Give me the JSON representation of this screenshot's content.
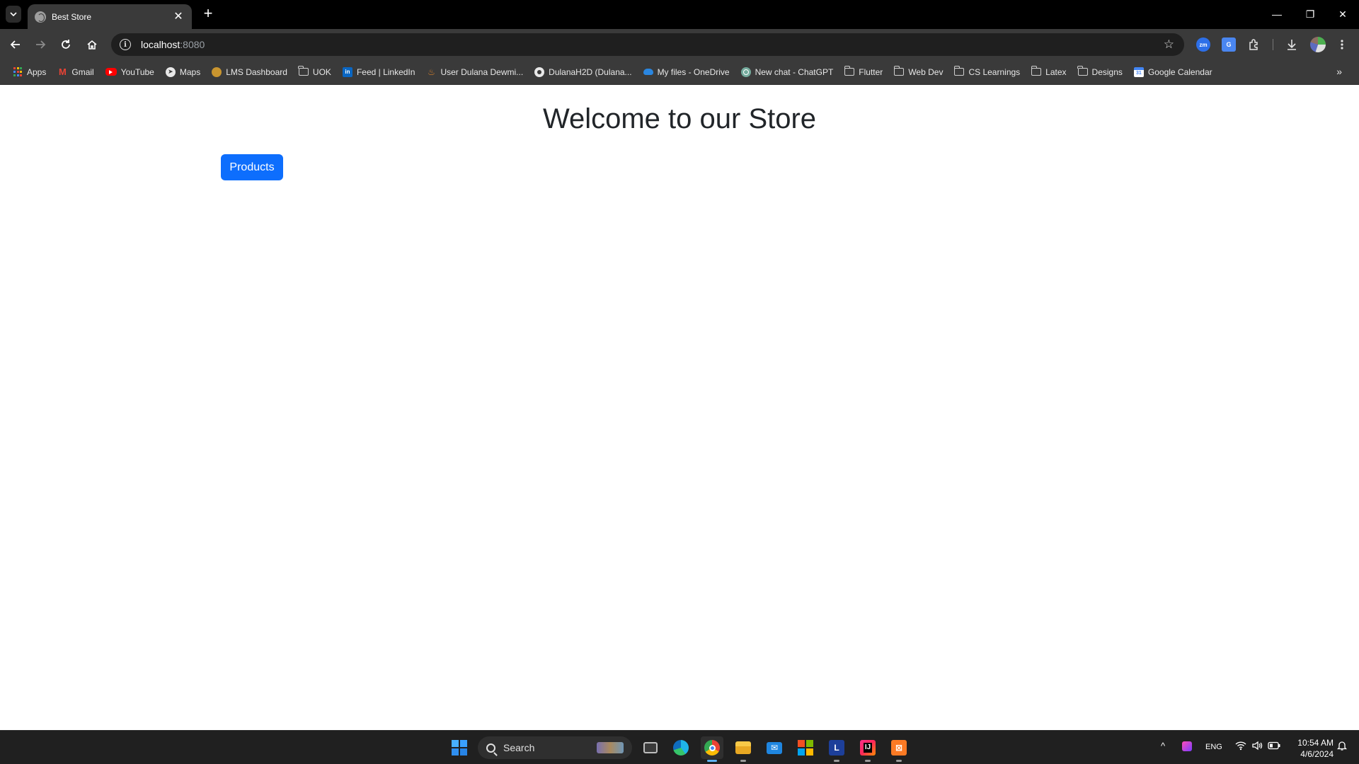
{
  "browser": {
    "tab": {
      "title": "Best Store",
      "close": "✕"
    },
    "new_tab": "+",
    "window_controls": {
      "minimize": "—",
      "restore": "❐",
      "close": "✕"
    },
    "address": {
      "host": "localhost",
      "port": ":8080"
    },
    "star": "☆",
    "extensions": {
      "zoom": "zm",
      "translate": "G"
    },
    "bookmarks": [
      {
        "label": "Apps",
        "icon": "apps-grid-icon"
      },
      {
        "label": "Gmail",
        "icon": "gmail-icon"
      },
      {
        "label": "YouTube",
        "icon": "youtube-icon"
      },
      {
        "label": "Maps",
        "icon": "maps-icon"
      },
      {
        "label": "LMS Dashboard",
        "icon": "lms-icon"
      },
      {
        "label": "UOK",
        "icon": "folder-icon"
      },
      {
        "label": "Feed | LinkedIn",
        "icon": "linkedin-icon"
      },
      {
        "label": "User Dulana Dewmi...",
        "icon": "user-icon"
      },
      {
        "label": "DulanaH2D (Dulana...",
        "icon": "github-icon"
      },
      {
        "label": "My files - OneDrive",
        "icon": "onedrive-icon"
      },
      {
        "label": "New chat - ChatGPT",
        "icon": "chatgpt-icon"
      },
      {
        "label": "Flutter",
        "icon": "folder-icon"
      },
      {
        "label": "Web Dev",
        "icon": "folder-icon"
      },
      {
        "label": "CS Learnings",
        "icon": "folder-icon"
      },
      {
        "label": "Latex",
        "icon": "folder-icon"
      },
      {
        "label": "Designs",
        "icon": "folder-icon"
      },
      {
        "label": "Google Calendar",
        "icon": "calendar-icon"
      }
    ],
    "bookmarks_more": "»"
  },
  "page": {
    "heading": "Welcome to our Store",
    "products_button": "Products",
    "colors": {
      "button": "#0d6efd",
      "heading": "#212529"
    }
  },
  "taskbar": {
    "search_placeholder": "Search",
    "apps": [
      {
        "name": "task-view",
        "glyph": ""
      },
      {
        "name": "edge",
        "glyph": "e"
      },
      {
        "name": "chrome",
        "glyph": ""
      },
      {
        "name": "file-explorer",
        "glyph": ""
      },
      {
        "name": "mail",
        "glyph": "✉"
      },
      {
        "name": "microsoft-store",
        "glyph": ""
      },
      {
        "name": "l-app",
        "glyph": "L"
      },
      {
        "name": "intellij",
        "glyph": "IJ"
      },
      {
        "name": "xampp",
        "glyph": "⊠"
      }
    ],
    "tray": {
      "chevron": "^",
      "language": "ENG"
    },
    "clock": {
      "time": "10:54 AM",
      "date": "4/6/2024"
    }
  }
}
